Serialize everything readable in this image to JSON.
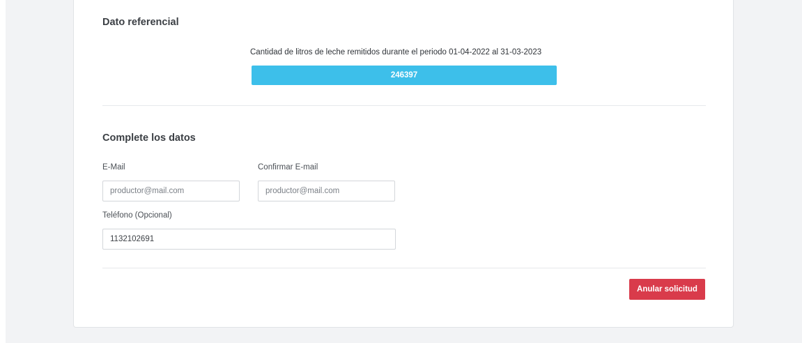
{
  "reference": {
    "title": "Dato referencial",
    "caption": "Cantidad de litros de leche remitidos durante el periodo 01-04-2022 al 31-03-2023",
    "value": "246397"
  },
  "form": {
    "title": "Complete los datos",
    "email": {
      "label": "E-Mail",
      "placeholder": "productor@mail.com"
    },
    "confirm_email": {
      "label": "Confirmar E-mail",
      "placeholder": "productor@mail.com"
    },
    "phone": {
      "label": "Teléfono (Opcional)",
      "value": "1132102691"
    }
  },
  "actions": {
    "cancel_label": "Anular solicitud",
    "cancel_color": "#d93b4b"
  },
  "colors": {
    "reference_bar": "#3dbfea",
    "page_background": "#f2f3f5"
  }
}
